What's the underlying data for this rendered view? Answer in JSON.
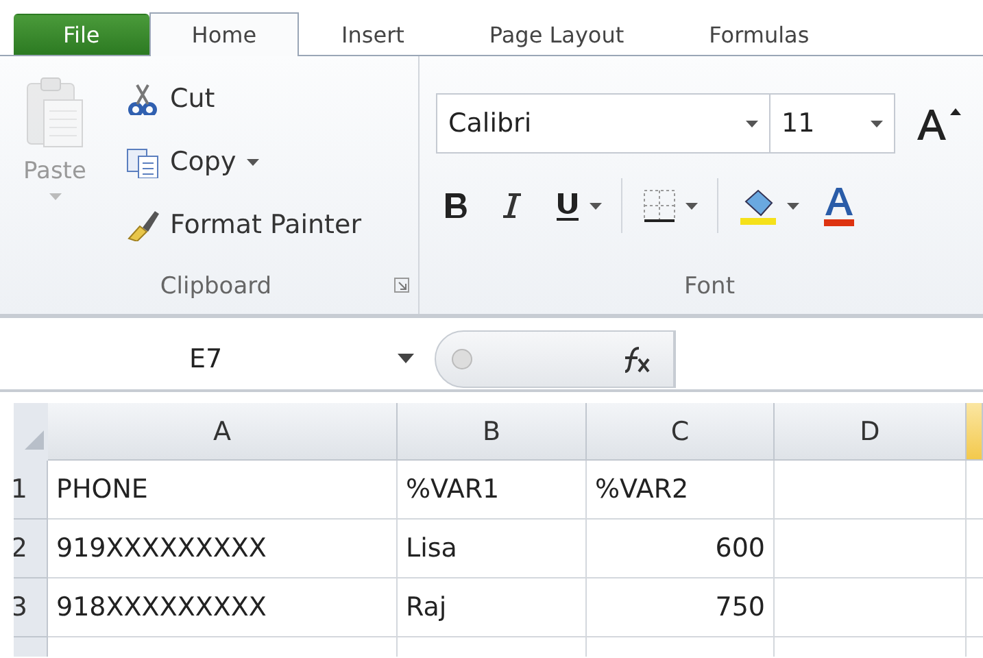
{
  "tabs": [
    {
      "label": "File",
      "kind": "file",
      "selected": false
    },
    {
      "label": "Home",
      "kind": "tab",
      "selected": true
    },
    {
      "label": "Insert",
      "kind": "tab",
      "selected": false
    },
    {
      "label": "Page Layout",
      "kind": "tab",
      "selected": false
    },
    {
      "label": "Formulas",
      "kind": "tab",
      "selected": false
    }
  ],
  "clipboard": {
    "label": "Clipboard",
    "paste": {
      "label": "Paste",
      "disabled": true
    },
    "commands": [
      {
        "label": "Cut",
        "kind": "cut",
        "has_menu": false
      },
      {
        "label": "Copy",
        "kind": "copy",
        "has_menu": true
      },
      {
        "label": "Format Painter",
        "kind": "painter",
        "has_menu": false
      }
    ]
  },
  "font": {
    "label": "Font",
    "font_name": "Calibri",
    "font_size": "11"
  },
  "formula_bar": {
    "name_box": "E7"
  },
  "sheet": {
    "columns": [
      {
        "label": "A",
        "selected": false
      },
      {
        "label": "B",
        "selected": false
      },
      {
        "label": "C",
        "selected": false
      },
      {
        "label": "D",
        "selected": false
      }
    ],
    "rows": [
      {
        "number": "1",
        "cells": [
          {
            "text": "PHONE",
            "kind": "text"
          },
          {
            "text": "%VAR1",
            "kind": "text"
          },
          {
            "text": "%VAR2",
            "kind": "text"
          },
          {
            "text": "",
            "kind": "text"
          }
        ]
      },
      {
        "number": "2",
        "cells": [
          {
            "text": "919XXXXXXXXX",
            "kind": "text"
          },
          {
            "text": "Lisa",
            "kind": "text"
          },
          {
            "text": "600",
            "kind": "number"
          },
          {
            "text": "",
            "kind": "text"
          }
        ]
      },
      {
        "number": "3",
        "cells": [
          {
            "text": "918XXXXXXXXX",
            "kind": "text"
          },
          {
            "text": "Raj",
            "kind": "text"
          },
          {
            "text": "750",
            "kind": "number"
          },
          {
            "text": "",
            "kind": "text"
          }
        ]
      }
    ]
  }
}
